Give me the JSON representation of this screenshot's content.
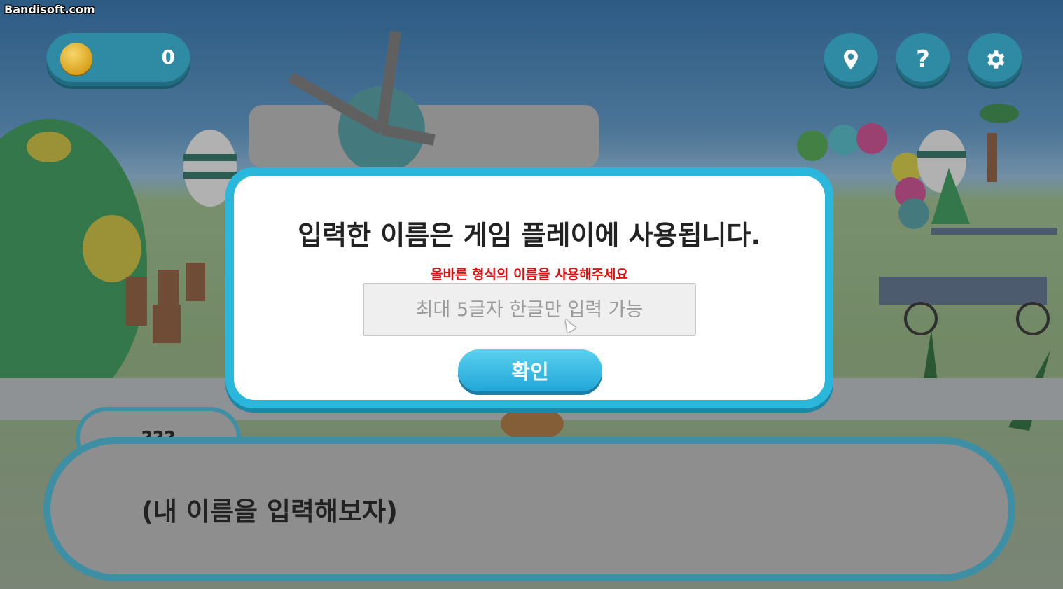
{
  "watermark": "Bandisoft.com",
  "hud": {
    "coin_count": "0",
    "buttons": [
      {
        "icon": "map-pin-icon"
      },
      {
        "icon": "help-icon",
        "label": "?"
      },
      {
        "icon": "gear-icon"
      }
    ]
  },
  "modal": {
    "title": "입력한 이름은 게임 플레이에 사용됩니다.",
    "error": "올바른 형식의 이름을 사용해주세요",
    "input_value": "",
    "input_placeholder": "최대 5글자 한글만 입력 가능",
    "confirm_label": "확인"
  },
  "dialog": {
    "speaker": "???",
    "text": "(내 이름을 입력해보자)"
  },
  "colors": {
    "hud_teal": "#2f8aa4",
    "modal_border": "#2bb7dc",
    "error_red": "#e01010",
    "dialog_fill": "#8e8e8e"
  }
}
